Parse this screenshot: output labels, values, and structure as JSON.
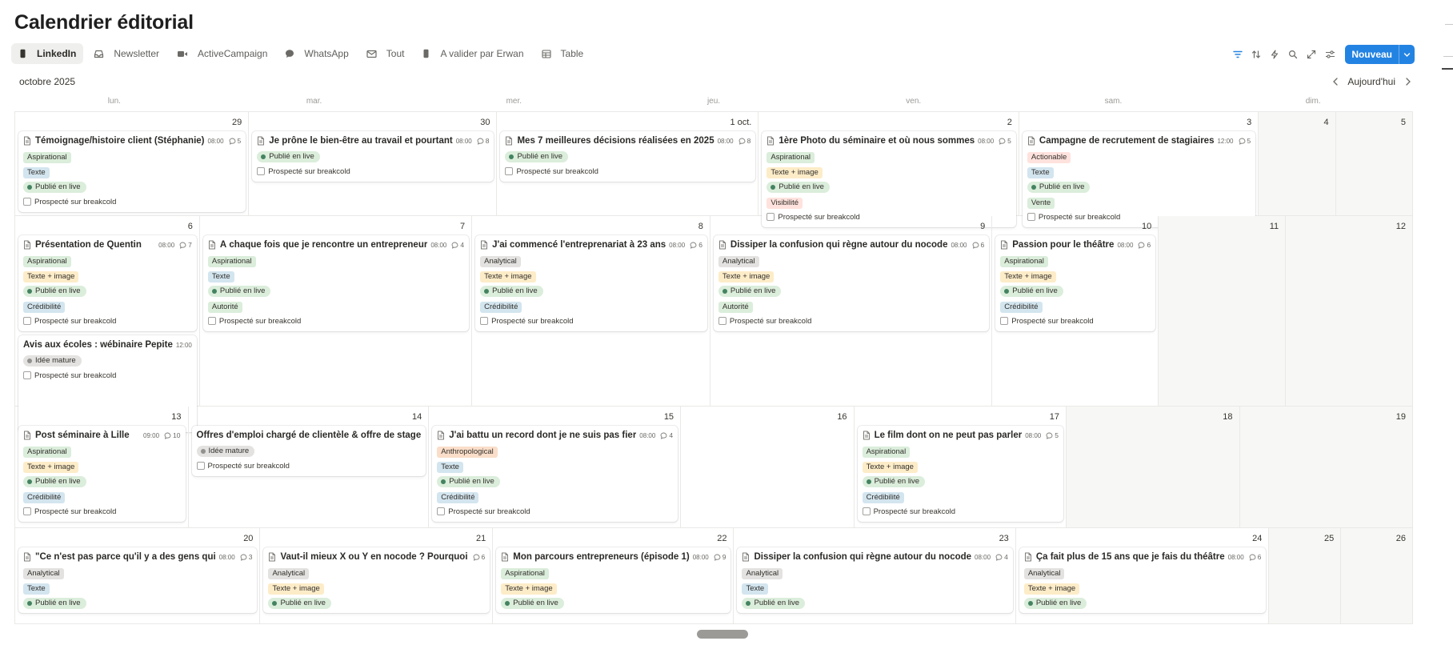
{
  "page": {
    "title": "Calendrier éditorial",
    "month_label": "octobre 2025",
    "today_label": "Aujourd'hui",
    "new_button_label": "Nouveau"
  },
  "tabs": [
    {
      "label": "LinkedIn",
      "icon": "phone-icon",
      "active": true
    },
    {
      "label": "Newsletter",
      "icon": "inbox-icon",
      "active": false
    },
    {
      "label": "ActiveCampaign",
      "icon": "video-icon",
      "active": false
    },
    {
      "label": "WhatsApp",
      "icon": "chat-bubble-icon",
      "active": false
    },
    {
      "label": "Tout",
      "icon": "mail-icon",
      "active": false
    },
    {
      "label": "A valider par Erwan",
      "icon": "phone-icon",
      "active": false
    },
    {
      "label": "Table",
      "icon": "table-icon",
      "active": false
    }
  ],
  "toolbar_icons": [
    "filter-icon",
    "sort-icon",
    "lightning-icon",
    "search-icon",
    "expand-icon",
    "settings-sliders-icon"
  ],
  "weekdays": [
    "lun.",
    "mar.",
    "mer.",
    "jeu.",
    "ven.",
    "sam.",
    "dim."
  ],
  "checkbox_label": "Prospecté sur breakcold",
  "weeks": [
    {
      "height": 130,
      "days": [
        {
          "num": "29",
          "cards": [
            {
              "title": "Témoignage/histoire client (Stéphanie)",
              "time": "08:00",
              "comments": "5",
              "doc": true,
              "tags": [
                {
                  "text": "Aspirational",
                  "cls": "t-asp"
                },
                {
                  "text": "Texte",
                  "cls": "t-tex"
                }
              ],
              "status": {
                "text": "Publié en live",
                "cls": "p-live"
              },
              "tags2": [],
              "checkbox": true
            }
          ]
        },
        {
          "num": "30",
          "cards": [
            {
              "title": "Je prône le bien-être au travail et pourtant",
              "time": "08:00",
              "comments": "8",
              "doc": true,
              "tags": [],
              "status": {
                "text": "Publié en live",
                "cls": "p-live"
              },
              "tags2": [],
              "checkbox": true
            }
          ]
        },
        {
          "num": "1 oct.",
          "cards": [
            {
              "title": "Mes 7 meilleures décisions réalisées en 2025",
              "time": "08:00",
              "comments": "8",
              "doc": true,
              "tags": [],
              "status": {
                "text": "Publié en live",
                "cls": "p-live"
              },
              "tags2": [],
              "checkbox": true
            }
          ]
        },
        {
          "num": "2",
          "cards": [
            {
              "title": "1ère Photo du séminaire et où nous sommes",
              "time": "08:00",
              "comments": "5",
              "doc": true,
              "tags": [
                {
                  "text": "Aspirational",
                  "cls": "t-asp"
                },
                {
                  "text": "Texte + image",
                  "cls": "t-txi"
                }
              ],
              "status": {
                "text": "Publié en live",
                "cls": "p-live"
              },
              "tags2": [
                {
                  "text": "Visibilité",
                  "cls": "t-vis"
                }
              ],
              "checkbox": true
            }
          ]
        },
        {
          "num": "3",
          "cards": [
            {
              "title": "Campagne de recrutement de stagiaires",
              "time": "12:00",
              "comments": "5",
              "doc": true,
              "tags": [
                {
                  "text": "Actionable",
                  "cls": "t-act"
                },
                {
                  "text": "Texte",
                  "cls": "t-tex"
                }
              ],
              "status": {
                "text": "Publié en live",
                "cls": "p-live"
              },
              "tags2": [
                {
                  "text": "Vente",
                  "cls": "t-ven"
                }
              ],
              "checkbox": true
            }
          ]
        },
        {
          "num": "4",
          "cards": [],
          "weekend": true
        },
        {
          "num": "5",
          "cards": [],
          "weekend": true
        }
      ]
    },
    {
      "height": 238,
      "days": [
        {
          "num": "6",
          "cards": [
            {
              "title": "Présentation de Quentin",
              "time": "08:00",
              "comments": "7",
              "doc": true,
              "tags": [
                {
                  "text": "Aspirational",
                  "cls": "t-asp"
                },
                {
                  "text": "Texte + image",
                  "cls": "t-txi"
                }
              ],
              "status": {
                "text": "Publié en live",
                "cls": "p-live"
              },
              "tags2": [
                {
                  "text": "Crédibilité",
                  "cls": "t-cre"
                }
              ],
              "checkbox": true
            },
            {
              "title": "Avis aux écoles : wébinaire Pepite",
              "time": "12:00",
              "comments": "",
              "doc": false,
              "tags": [],
              "status": {
                "text": "Idée mature",
                "cls": "p-idee"
              },
              "tags2": [],
              "checkbox": true,
              "tall": true
            }
          ]
        },
        {
          "num": "7",
          "cards": [
            {
              "title": "À chaque fois que je rencontre un entrepreneur",
              "time": "08:00",
              "comments": "4",
              "doc": true,
              "tags": [
                {
                  "text": "Aspirational",
                  "cls": "t-asp"
                },
                {
                  "text": "Texte",
                  "cls": "t-tex"
                }
              ],
              "status": {
                "text": "Publié en live",
                "cls": "p-live"
              },
              "tags2": [
                {
                  "text": "Autorité",
                  "cls": "t-aut"
                }
              ],
              "checkbox": true
            }
          ]
        },
        {
          "num": "8",
          "cards": [
            {
              "title": "J'ai commencé l'entreprenariat à 23 ans",
              "time": "08:00",
              "comments": "6",
              "doc": true,
              "tags": [
                {
                  "text": "Analytical",
                  "cls": "t-ana"
                },
                {
                  "text": "Texte + image",
                  "cls": "t-txi"
                }
              ],
              "status": {
                "text": "Publié en live",
                "cls": "p-live"
              },
              "tags2": [
                {
                  "text": "Crédibilité",
                  "cls": "t-cre"
                }
              ],
              "checkbox": true
            }
          ]
        },
        {
          "num": "9",
          "cards": [
            {
              "title": "Dissiper la confusion qui règne autour du nocode",
              "time": "08:00",
              "comments": "6",
              "doc": true,
              "tags": [
                {
                  "text": "Analytical",
                  "cls": "t-ana"
                },
                {
                  "text": "Texte + image",
                  "cls": "t-txi"
                }
              ],
              "status": {
                "text": "Publié en live",
                "cls": "p-live"
              },
              "tags2": [
                {
                  "text": "Autorité",
                  "cls": "t-aut"
                }
              ],
              "checkbox": true
            }
          ]
        },
        {
          "num": "10",
          "cards": [
            {
              "title": "Passion pour le théâtre",
              "time": "08:00",
              "comments": "6",
              "doc": true,
              "tags": [
                {
                  "text": "Aspirational",
                  "cls": "t-asp"
                },
                {
                  "text": "Texte + image",
                  "cls": "t-txi"
                }
              ],
              "status": {
                "text": "Publié en live",
                "cls": "p-live"
              },
              "tags2": [
                {
                  "text": "Crédibilité",
                  "cls": "t-cre"
                }
              ],
              "checkbox": true
            }
          ]
        },
        {
          "num": "11",
          "cards": [],
          "weekend": true
        },
        {
          "num": "12",
          "cards": [],
          "weekend": true
        }
      ]
    },
    {
      "height": 152,
      "days": [
        {
          "num": "13",
          "cards": [
            {
              "title": "Post séminaire à Lille",
              "time": "09:00",
              "comments": "10",
              "doc": true,
              "tags": [
                {
                  "text": "Aspirational",
                  "cls": "t-asp"
                },
                {
                  "text": "Texte + image",
                  "cls": "t-txi"
                }
              ],
              "status": {
                "text": "Publié en live",
                "cls": "p-live"
              },
              "tags2": [
                {
                  "text": "Crédibilité",
                  "cls": "t-cre"
                }
              ],
              "checkbox": true
            }
          ]
        },
        {
          "num": "14",
          "cards": [
            {
              "title": "Offres d'emploi chargé de clientèle & offre de stage",
              "time": "",
              "comments": "",
              "doc": false,
              "tags": [],
              "status": {
                "text": "Idée mature",
                "cls": "p-idee"
              },
              "tags2": [],
              "checkbox": true
            }
          ]
        },
        {
          "num": "15",
          "cards": [
            {
              "title": "J'ai battu un record dont je ne suis pas fier",
              "time": "08:00",
              "comments": "4",
              "doc": true,
              "tags": [
                {
                  "text": "Anthropological",
                  "cls": "t-ant"
                },
                {
                  "text": "Texte",
                  "cls": "t-tex"
                }
              ],
              "status": {
                "text": "Publié en live",
                "cls": "p-live"
              },
              "tags2": [
                {
                  "text": "Crédibilité",
                  "cls": "t-cre"
                }
              ],
              "checkbox": true
            }
          ]
        },
        {
          "num": "16",
          "cards": []
        },
        {
          "num": "17",
          "cards": [
            {
              "title": "Le film dont on ne peut pas parler",
              "time": "08:00",
              "comments": "5",
              "doc": true,
              "tags": [
                {
                  "text": "Aspirational",
                  "cls": "t-asp"
                },
                {
                  "text": "Texte + image",
                  "cls": "t-txi"
                }
              ],
              "status": {
                "text": "Publié en live",
                "cls": "p-live"
              },
              "tags2": [
                {
                  "text": "Crédibilité",
                  "cls": "t-cre"
                }
              ],
              "checkbox": true
            }
          ]
        },
        {
          "num": "18",
          "cards": [],
          "weekend": true
        },
        {
          "num": "19",
          "cards": [],
          "weekend": true
        }
      ]
    },
    {
      "height": 120,
      "days": [
        {
          "num": "20",
          "cards": [
            {
              "title": "\"Ce n'est pas parce qu'il y a des gens qui",
              "time": "08:00",
              "comments": "3",
              "doc": true,
              "tags": [
                {
                  "text": "Analytical",
                  "cls": "t-ana"
                },
                {
                  "text": "Texte",
                  "cls": "t-tex"
                }
              ],
              "status": {
                "text": "Publié en live",
                "cls": "p-live"
              },
              "tags2": [],
              "checkbox": false
            }
          ]
        },
        {
          "num": "21",
          "cards": [
            {
              "title": "Vaut-il mieux X ou Y en nocode ? Pourquoi",
              "time": "",
              "comments": "6",
              "doc": true,
              "tags": [
                {
                  "text": "Analytical",
                  "cls": "t-ana"
                },
                {
                  "text": "Texte + image",
                  "cls": "t-txi"
                }
              ],
              "status": {
                "text": "Publié en live",
                "cls": "p-live"
              },
              "tags2": [],
              "checkbox": false
            }
          ]
        },
        {
          "num": "22",
          "cards": [
            {
              "title": "Mon parcours entrepreneurs (épisode 1)",
              "time": "08:00",
              "comments": "9",
              "doc": true,
              "tags": [
                {
                  "text": "Aspirational",
                  "cls": "t-asp"
                },
                {
                  "text": "Texte + image",
                  "cls": "t-txi"
                }
              ],
              "status": {
                "text": "Publié en live",
                "cls": "p-live"
              },
              "tags2": [],
              "checkbox": false
            }
          ]
        },
        {
          "num": "23",
          "cards": [
            {
              "title": "Dissiper la confusion qui règne autour du nocode",
              "time": "08:00",
              "comments": "4",
              "doc": true,
              "tags": [
                {
                  "text": "Analytical",
                  "cls": "t-ana"
                },
                {
                  "text": "Texte",
                  "cls": "t-tex"
                }
              ],
              "status": {
                "text": "Publié en live",
                "cls": "p-live"
              },
              "tags2": [],
              "checkbox": false
            }
          ]
        },
        {
          "num": "24",
          "cards": [
            {
              "title": "Ça fait plus de 15 ans que je fais du théâtre",
              "time": "08:00",
              "comments": "6",
              "doc": true,
              "tags": [
                {
                  "text": "Analytical",
                  "cls": "t-ana"
                },
                {
                  "text": "Texte + image",
                  "cls": "t-txi"
                }
              ],
              "status": {
                "text": "Publié en live",
                "cls": "p-live"
              },
              "tags2": [],
              "checkbox": false
            }
          ]
        },
        {
          "num": "25",
          "cards": [],
          "weekend": true
        },
        {
          "num": "26",
          "cards": [],
          "weekend": true
        }
      ]
    }
  ]
}
